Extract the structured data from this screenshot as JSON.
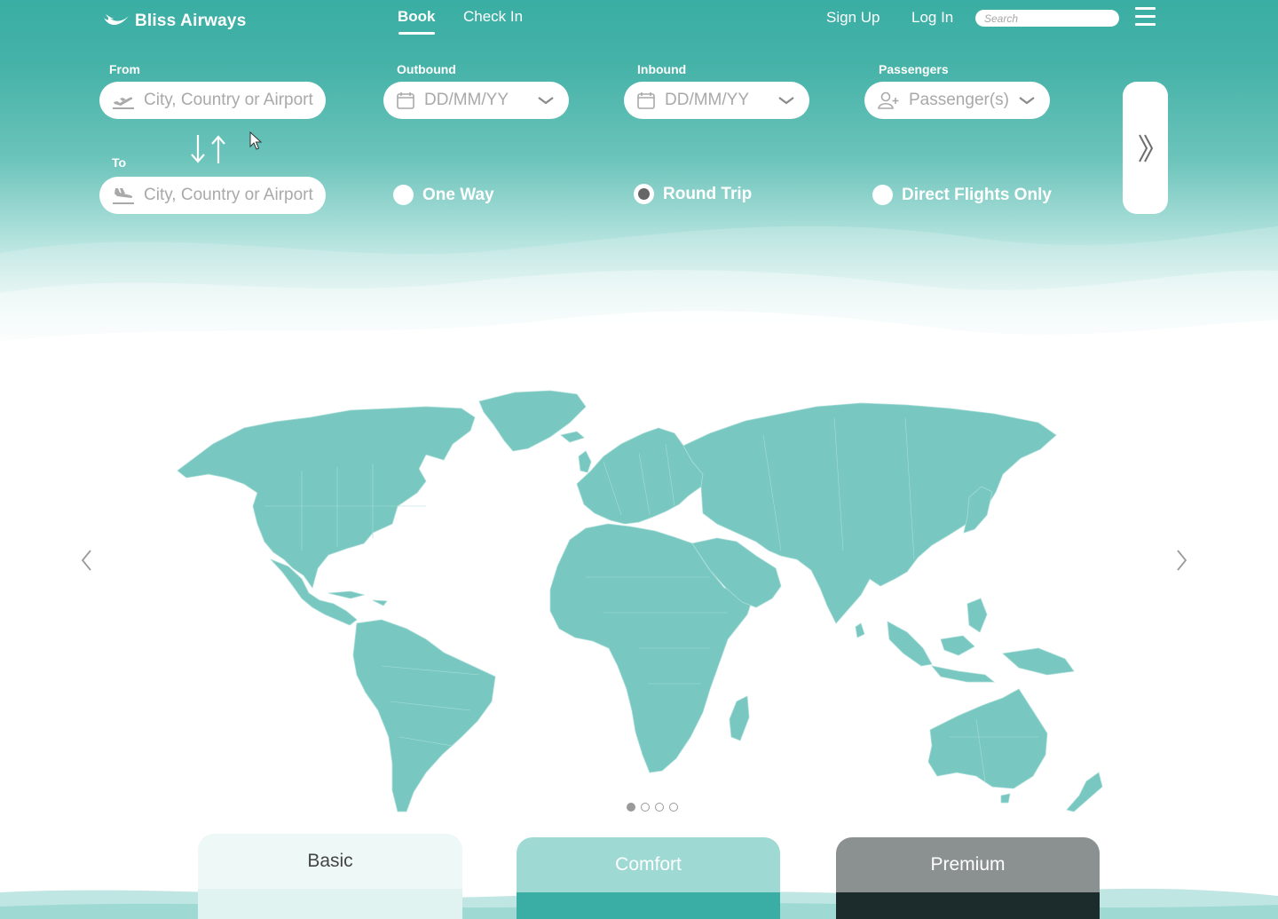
{
  "brand": {
    "name": "Bliss Airways"
  },
  "nav": {
    "tabs": [
      {
        "label": "Book",
        "active": true
      },
      {
        "label": "Check In",
        "active": false
      }
    ],
    "sign_up": "Sign Up",
    "log_in": "Log In",
    "search_placeholder": "Search"
  },
  "form": {
    "from": {
      "label": "From",
      "placeholder": "City, Country or Airport"
    },
    "to": {
      "label": "To",
      "placeholder": "City, Country or Airport"
    },
    "outbound": {
      "label": "Outbound",
      "placeholder": "DD/MM/YY"
    },
    "inbound": {
      "label": "Inbound",
      "placeholder": "DD/MM/YY"
    },
    "passengers": {
      "label": "Passengers",
      "placeholder": "Passenger(s)"
    },
    "options": [
      {
        "label": "One Way",
        "selected": false
      },
      {
        "label": "Round Trip",
        "selected": true
      },
      {
        "label": "Direct Flights Only",
        "selected": false
      }
    ],
    "submit_icon": "double-chevron-right-icon"
  },
  "carousel": {
    "slide_count": 4,
    "active_index": 0
  },
  "fare_classes": [
    {
      "name": "Basic"
    },
    {
      "name": "Comfort"
    },
    {
      "name": "Premium"
    }
  ],
  "colors": {
    "brand_teal": "#3aaea4",
    "map_fill": "#78c8c1",
    "comfort_head": "#9ed9d3",
    "comfort_body": "#3aaea4",
    "premium_head": "#8a9190",
    "premium_body": "#1c2b2c",
    "basic_head": "#eef8f7"
  }
}
